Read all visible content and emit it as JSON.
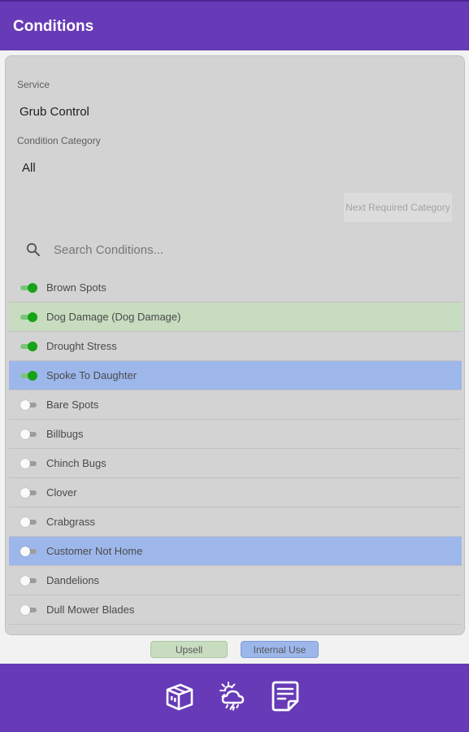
{
  "header": {
    "title": "Conditions"
  },
  "form": {
    "service_label": "Service",
    "service_value": "Grub Control",
    "category_label": "Condition Category",
    "category_value": "All",
    "next_button_label": "Next Required Category"
  },
  "search": {
    "placeholder": "Search Conditions..."
  },
  "conditions": [
    {
      "label": "Brown Spots",
      "enabled": true,
      "highlight": "none"
    },
    {
      "label": "Dog Damage (Dog Damage)",
      "enabled": true,
      "highlight": "upsell"
    },
    {
      "label": "Drought Stress",
      "enabled": true,
      "highlight": "none"
    },
    {
      "label": "Spoke To Daughter",
      "enabled": true,
      "highlight": "internal"
    },
    {
      "label": "Bare Spots",
      "enabled": false,
      "highlight": "none"
    },
    {
      "label": "Billbugs",
      "enabled": false,
      "highlight": "none"
    },
    {
      "label": "Chinch Bugs",
      "enabled": false,
      "highlight": "none"
    },
    {
      "label": "Clover",
      "enabled": false,
      "highlight": "none"
    },
    {
      "label": "Crabgrass",
      "enabled": false,
      "highlight": "none"
    },
    {
      "label": "Customer Not Home",
      "enabled": false,
      "highlight": "internal"
    },
    {
      "label": "Dandelions",
      "enabled": false,
      "highlight": "none"
    },
    {
      "label": "Dull Mower Blades",
      "enabled": false,
      "highlight": "none"
    }
  ],
  "legend": {
    "upsell": "Upsell",
    "internal": "Internal Use"
  },
  "bottom_nav": [
    {
      "icon": "package-icon"
    },
    {
      "icon": "weather-icon"
    },
    {
      "icon": "notes-icon"
    }
  ],
  "colors": {
    "primary": "#673ab7",
    "upsell": "#c8dcc0",
    "internal": "#9db7eb",
    "switch_on": "#16a316"
  }
}
